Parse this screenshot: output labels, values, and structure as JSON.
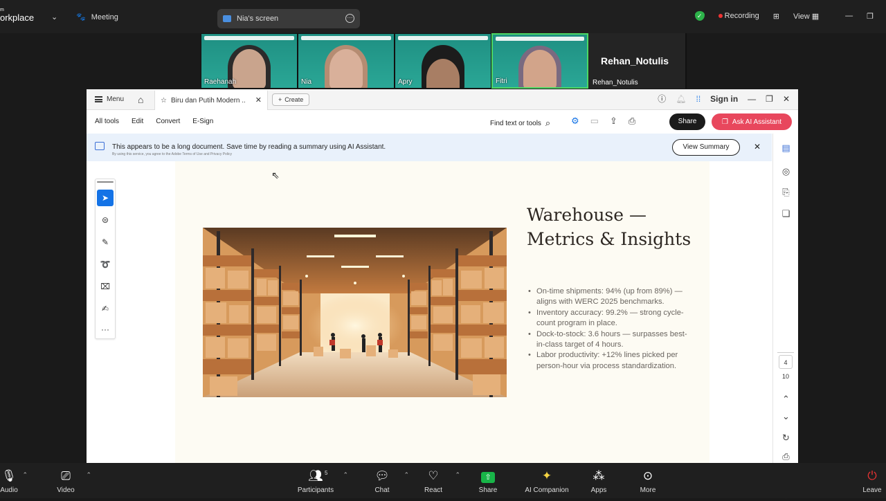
{
  "zoom": {
    "brand_top": "m",
    "brand": "orkplace",
    "meeting_label": "Meeting",
    "share_pill": "Nia's screen",
    "recording_label": "Recording",
    "view_label": "View",
    "participants": [
      {
        "name": "Raehanah"
      },
      {
        "name": "Nia"
      },
      {
        "name": "Apry"
      },
      {
        "name": "Fitri"
      }
    ],
    "name_tile": {
      "big": "Rehan_Notulis",
      "label": "Rehan_Notulis"
    },
    "bottom": {
      "audio": "Audio",
      "video": "Video",
      "participants": "Participants",
      "participants_count": "5",
      "chat": "Chat",
      "react": "React",
      "share": "Share",
      "ai_companion": "AI Companion",
      "apps": "Apps",
      "more": "More",
      "leave": "Leave"
    }
  },
  "acrobat": {
    "menu_label": "Menu",
    "tab_title": "Biru dan Putih Modern ..",
    "create_label": "Create",
    "sign_in": "Sign in",
    "toolbar": {
      "all_tools": "All tools",
      "edit": "Edit",
      "convert": "Convert",
      "esign": "E-Sign",
      "find": "Find text or tools",
      "share": "Share",
      "ask_ai": "Ask AI Assistant"
    },
    "banner": {
      "message": "This appears to be a long document. Save time by reading a summary using AI Assistant.",
      "fine_print": "By using this service, you agree to the Adobe Terms of Use and Privacy Policy",
      "view_summary": "View Summary"
    },
    "page_nav": {
      "current": "4",
      "total": "10"
    }
  },
  "slide": {
    "title": "Warehouse — Metrics & Insights",
    "bullets": [
      "On-time shipments: 94% (up from 89%) — aligns with WERC 2025 benchmarks.",
      "Inventory accuracy: 99.2% — strong cycle-count program in place.",
      "Dock-to-stock: 3.6 hours — surpasses best-in-class target of 4 hours.",
      "Labor productivity: +12% lines picked per person-hour via process standardization."
    ]
  },
  "colors": {
    "ai_button": "#e8475d",
    "selected_tool": "#1473e6",
    "zoom_share": "#18b548",
    "slide_bg": "#fdfbf3"
  }
}
